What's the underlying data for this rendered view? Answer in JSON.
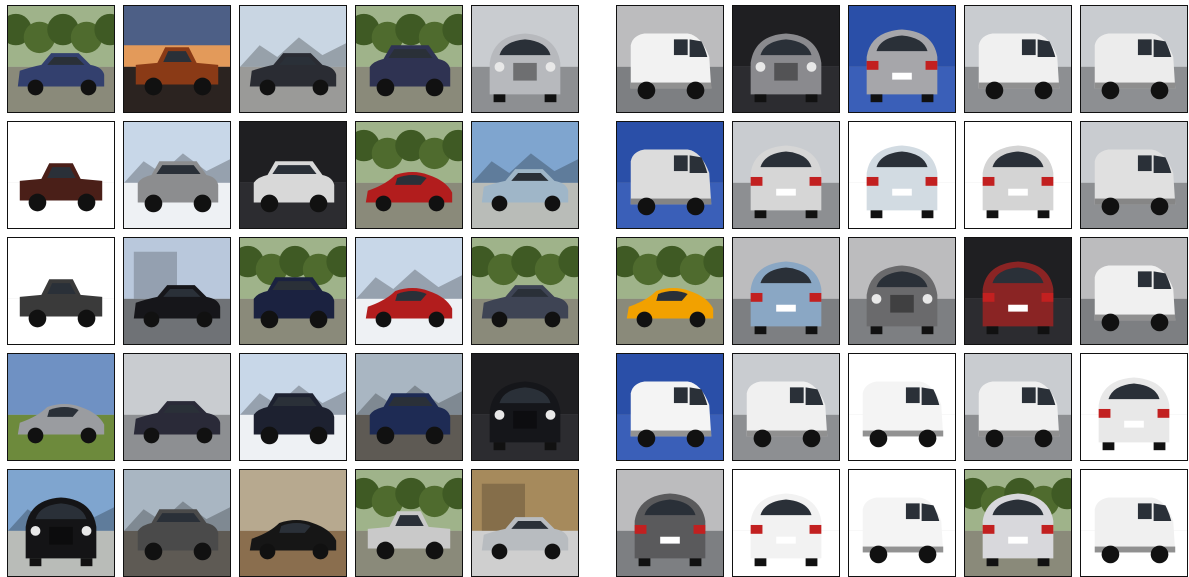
{
  "panels": [
    {
      "id": "left",
      "tiles": [
        {
          "bg": "forest",
          "car": "sedan",
          "color": "#33406e"
        },
        {
          "bg": "sunset",
          "car": "truck",
          "color": "#8a3a16"
        },
        {
          "bg": "cloudy",
          "car": "sedan",
          "color": "#2a2c33"
        },
        {
          "bg": "forest",
          "car": "suv",
          "color": "#2f3352"
        },
        {
          "bg": "street",
          "car": "front",
          "color": "#b7b9bd"
        },
        {
          "bg": "white",
          "car": "truck",
          "color": "#4a1f18"
        },
        {
          "bg": "snow",
          "car": "suv",
          "color": "#8c8d8f"
        },
        {
          "bg": "dark",
          "car": "suv",
          "color": "#d8d8d8"
        },
        {
          "bg": "forest",
          "car": "sport",
          "color": "#b21d1d"
        },
        {
          "bg": "sky",
          "car": "sedan",
          "color": "#9fb6c8"
        },
        {
          "bg": "white",
          "car": "truck",
          "color": "#3a3a3a"
        },
        {
          "bg": "city",
          "car": "sedan",
          "color": "#16161a"
        },
        {
          "bg": "forest",
          "car": "suv",
          "color": "#1b2240"
        },
        {
          "bg": "snow",
          "car": "sport",
          "color": "#b21d1d"
        },
        {
          "bg": "forest",
          "car": "sedan",
          "color": "#3e4454"
        },
        {
          "bg": "grass",
          "car": "sport",
          "color": "#9a9ca0"
        },
        {
          "bg": "street",
          "car": "sedan",
          "color": "#2a2a38"
        },
        {
          "bg": "snow",
          "car": "suv",
          "color": "#1d2130"
        },
        {
          "bg": "rock",
          "car": "suv",
          "color": "#1e2b54"
        },
        {
          "bg": "dark",
          "car": "front",
          "color": "#15161a"
        },
        {
          "bg": "sky",
          "car": "front",
          "color": "#141416"
        },
        {
          "bg": "rock",
          "car": "suv",
          "color": "#4a4a4a"
        },
        {
          "bg": "dirt",
          "car": "sport",
          "color": "#161616"
        },
        {
          "bg": "forest",
          "car": "truck",
          "color": "#c9c9c9"
        },
        {
          "bg": "dealer",
          "car": "sedan",
          "color": "#b8bcc0"
        }
      ]
    },
    {
      "id": "right",
      "tiles": [
        {
          "bg": "gray",
          "car": "van",
          "color": "#f2f2f2"
        },
        {
          "bg": "dark",
          "car": "front",
          "color": "#8a8a8e"
        },
        {
          "bg": "blue",
          "car": "rear",
          "color": "#a6a6aa"
        },
        {
          "bg": "street",
          "car": "van",
          "color": "#f0f0f0"
        },
        {
          "bg": "street",
          "car": "van",
          "color": "#ececec"
        },
        {
          "bg": "blue",
          "car": "van",
          "color": "#dcdcdc"
        },
        {
          "bg": "street",
          "car": "rear",
          "color": "#d6d6d6"
        },
        {
          "bg": "white",
          "car": "rear",
          "color": "#d2dbe2"
        },
        {
          "bg": "white",
          "car": "rear",
          "color": "#d4d4d4"
        },
        {
          "bg": "street",
          "car": "van",
          "color": "#e0e0e0"
        },
        {
          "bg": "forest",
          "car": "sport",
          "color": "#f2a100"
        },
        {
          "bg": "gray",
          "car": "rear",
          "color": "#8aa7c4"
        },
        {
          "bg": "gray",
          "car": "front",
          "color": "#6a6a6c"
        },
        {
          "bg": "dark",
          "car": "rear",
          "color": "#8a2424"
        },
        {
          "bg": "gray",
          "car": "van",
          "color": "#f0f0f0"
        },
        {
          "bg": "blue",
          "car": "van",
          "color": "#f4f4f4"
        },
        {
          "bg": "street",
          "car": "van",
          "color": "#f0f0f0"
        },
        {
          "bg": "white",
          "car": "van",
          "color": "#f4f4f4"
        },
        {
          "bg": "street",
          "car": "van",
          "color": "#f0f0f0"
        },
        {
          "bg": "white",
          "car": "rear",
          "color": "#e8e8e8"
        },
        {
          "bg": "gray",
          "car": "rear",
          "color": "#5a5a5c"
        },
        {
          "bg": "white",
          "car": "rear",
          "color": "#f2f2f2"
        },
        {
          "bg": "white",
          "car": "van",
          "color": "#f4f4f4"
        },
        {
          "bg": "forest",
          "car": "rear",
          "color": "#d8d8dc"
        },
        {
          "bg": "white",
          "car": "van",
          "color": "#f0f0f0"
        }
      ]
    }
  ]
}
